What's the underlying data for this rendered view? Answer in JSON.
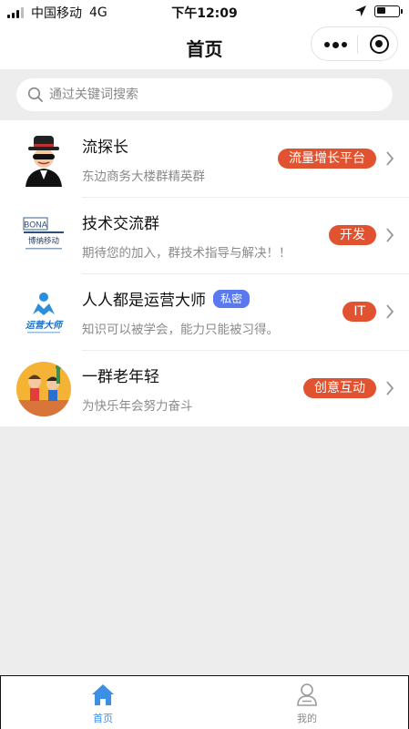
{
  "status_bar": {
    "carrier": "中国移动",
    "network": "4G",
    "time": "下午12:09"
  },
  "nav": {
    "title": "首页"
  },
  "search": {
    "placeholder": "通过关键词搜索"
  },
  "groups": [
    {
      "name": "流探长",
      "desc": "东边商务大楼群精英群",
      "tag": "流量增长平台"
    },
    {
      "name": "技术交流群",
      "desc": "期待您的加入，群技术指导与解决！！",
      "tag": "开发"
    },
    {
      "name": "人人都是运营大师",
      "badge": "私密",
      "desc": "知识可以被学会，能力只能被习得。",
      "tag": "IT"
    },
    {
      "name": "一群老年轻",
      "desc": "为快乐年会努力奋斗",
      "tag": "创意互动"
    }
  ],
  "logo_text": {
    "bona": "BONA",
    "bona_cn": "博纳移动",
    "yunying": "运营大师"
  },
  "tabs": [
    {
      "label": "首页",
      "active": true
    },
    {
      "label": "我的",
      "active": false
    }
  ],
  "colors": {
    "tag": "#e15330",
    "private_badge": "#5a78f0",
    "tab_active": "#3d8ee5"
  }
}
